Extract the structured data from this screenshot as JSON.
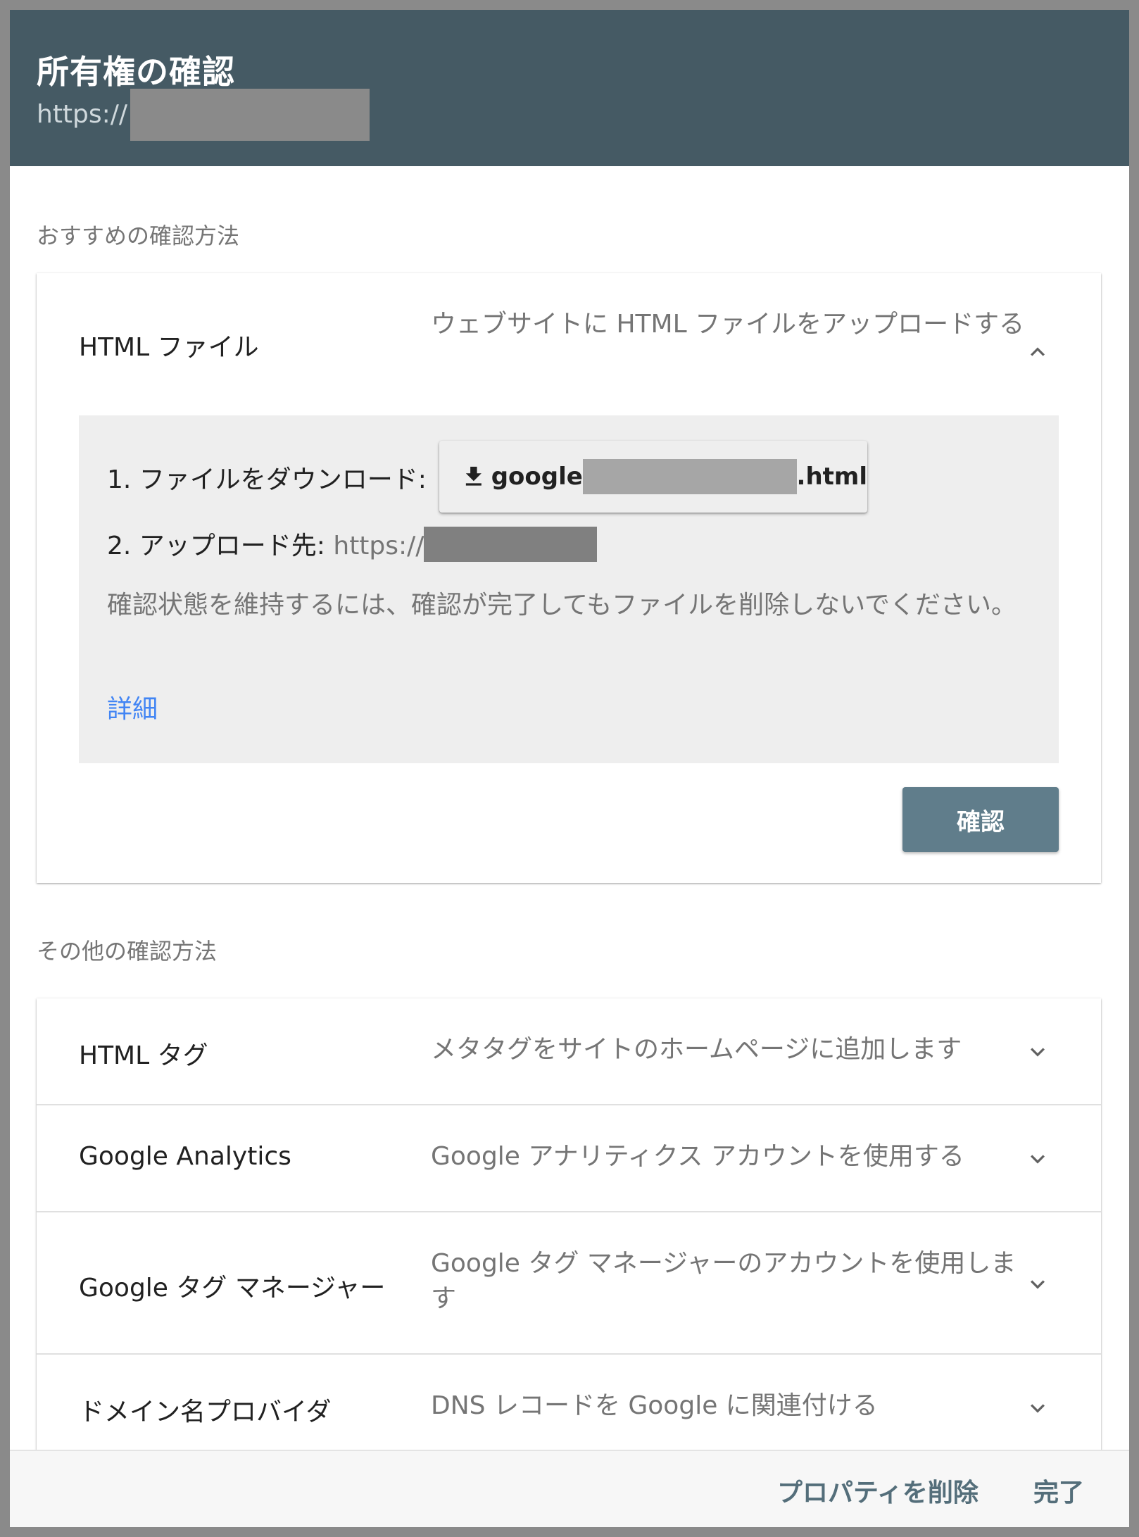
{
  "header": {
    "title": "所有権の確認",
    "url_prefix": "https://"
  },
  "recommended": {
    "section_label": "おすすめの確認方法",
    "method": {
      "title": "HTML ファイル",
      "description": "ウェブサイトに HTML ファイルをアップロードする",
      "expanded": true,
      "step1_label": "1. ファイルをダウンロード:",
      "download_prefix": "google",
      "download_suffix": ".html",
      "step2_label": "2. アップロード先:",
      "step2_url_prefix": "https://",
      "note": "確認状態を維持するには、確認が完了してもファイルを削除しないでください。",
      "details_link": "詳細",
      "confirm_button": "確認"
    }
  },
  "other": {
    "section_label": "その他の確認方法",
    "methods": [
      {
        "title": "HTML タグ",
        "description": "メタタグをサイトのホームページに追加します"
      },
      {
        "title": "Google Analytics",
        "description": "Google アナリティクス アカウントを使用する"
      },
      {
        "title": "Google タグ マネージャー",
        "description": "Google タグ マネージャーのアカウントを使用します"
      },
      {
        "title": "ドメイン名プロバイダ",
        "description": "DNS レコードを Google に関連付ける"
      }
    ]
  },
  "footer": {
    "delete_property": "プロパティを削除",
    "done": "完了"
  },
  "colors": {
    "header_bg": "#455a64",
    "confirm_bg": "#607d8b",
    "link": "#4285f4"
  }
}
